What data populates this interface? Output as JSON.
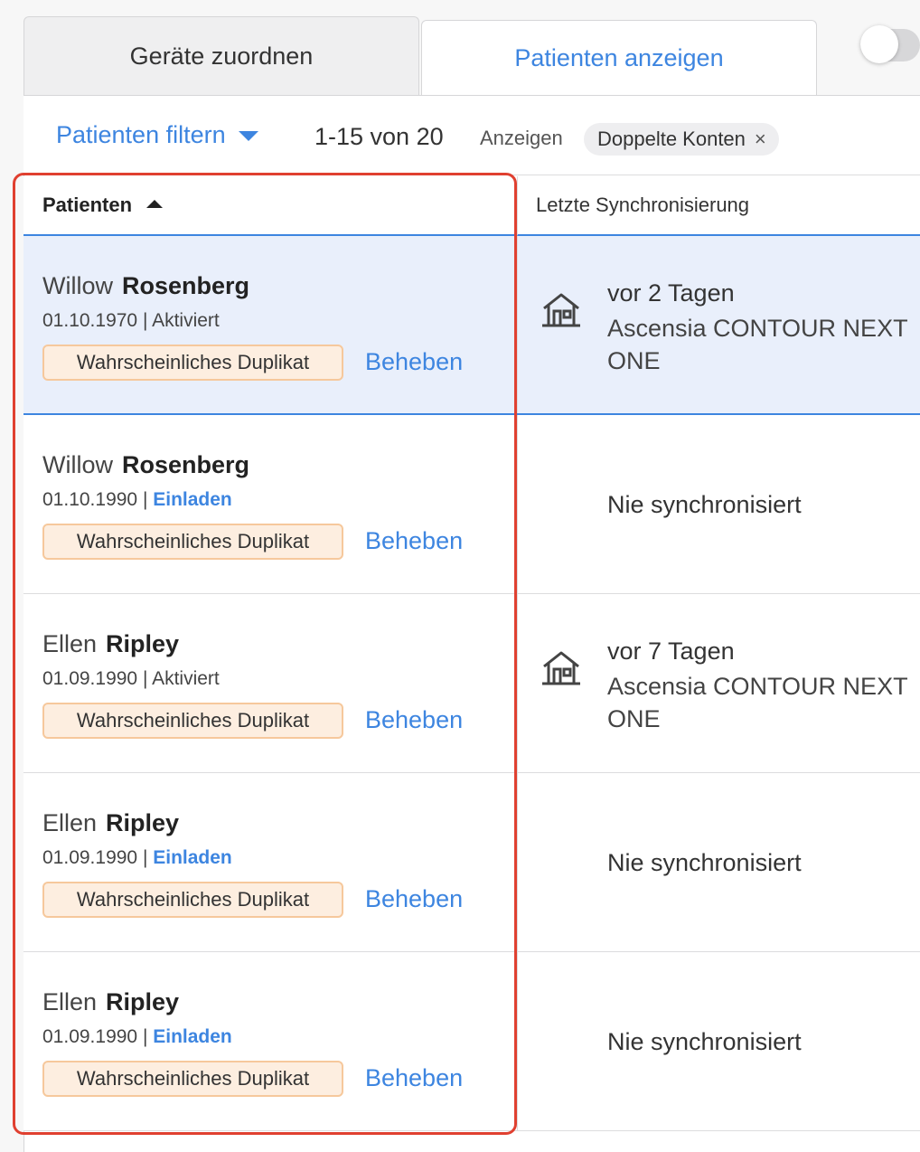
{
  "tabs": {
    "assign_devices": "Geräte zuordnen",
    "show_patients": "Patienten anzeigen"
  },
  "filter": {
    "filter_label": "Patienten filtern",
    "count": "1-15 von 20",
    "show_label": "Anzeigen",
    "chip_label": "Doppelte Konten",
    "chip_remove": "×"
  },
  "columns": {
    "patients": "Patienten",
    "last_sync": "Letzte Synchronisierung"
  },
  "rows": [
    {
      "first": "Willow",
      "last": "Rosenberg",
      "dob": "01.10.1970",
      "sep": " | ",
      "status": "Aktiviert",
      "badge": "Wahrscheinliches Duplikat",
      "action": "Beheben",
      "sync": "vor 2 Tagen",
      "device": "Ascensia CONTOUR NEXT ONE"
    },
    {
      "first": "Willow",
      "last": "Rosenberg",
      "dob": "01.10.1990",
      "sep": " | ",
      "status": "Einladen",
      "badge": "Wahrscheinliches Duplikat",
      "action": "Beheben",
      "never": "Nie synchronisiert"
    },
    {
      "first": "Ellen",
      "last": "Ripley",
      "dob": "01.09.1990",
      "sep": " | ",
      "status": "Aktiviert",
      "badge": "Wahrscheinliches Duplikat",
      "action": "Beheben",
      "sync": "vor 7 Tagen",
      "device": "Ascensia CONTOUR NEXT ONE"
    },
    {
      "first": "Ellen",
      "last": "Ripley",
      "dob": "01.09.1990",
      "sep": " | ",
      "status": "Einladen",
      "badge": "Wahrscheinliches Duplikat",
      "action": "Beheben",
      "never": "Nie synchronisiert"
    },
    {
      "first": "Ellen",
      "last": "Ripley",
      "dob": "01.09.1990",
      "sep": " | ",
      "status": "Einladen",
      "badge": "Wahrscheinliches Duplikat",
      "action": "Beheben",
      "never": "Nie synchronisiert"
    }
  ],
  "colors": {
    "accent": "#3d85e0",
    "highlight": "#e04030",
    "badge_bg": "#fdeee0",
    "badge_border": "#f6c89c",
    "selected_row": "#e9effb"
  },
  "icons": {
    "home": "home-icon",
    "sort": "caret-up-icon",
    "dropdown": "caret-down-icon"
  }
}
